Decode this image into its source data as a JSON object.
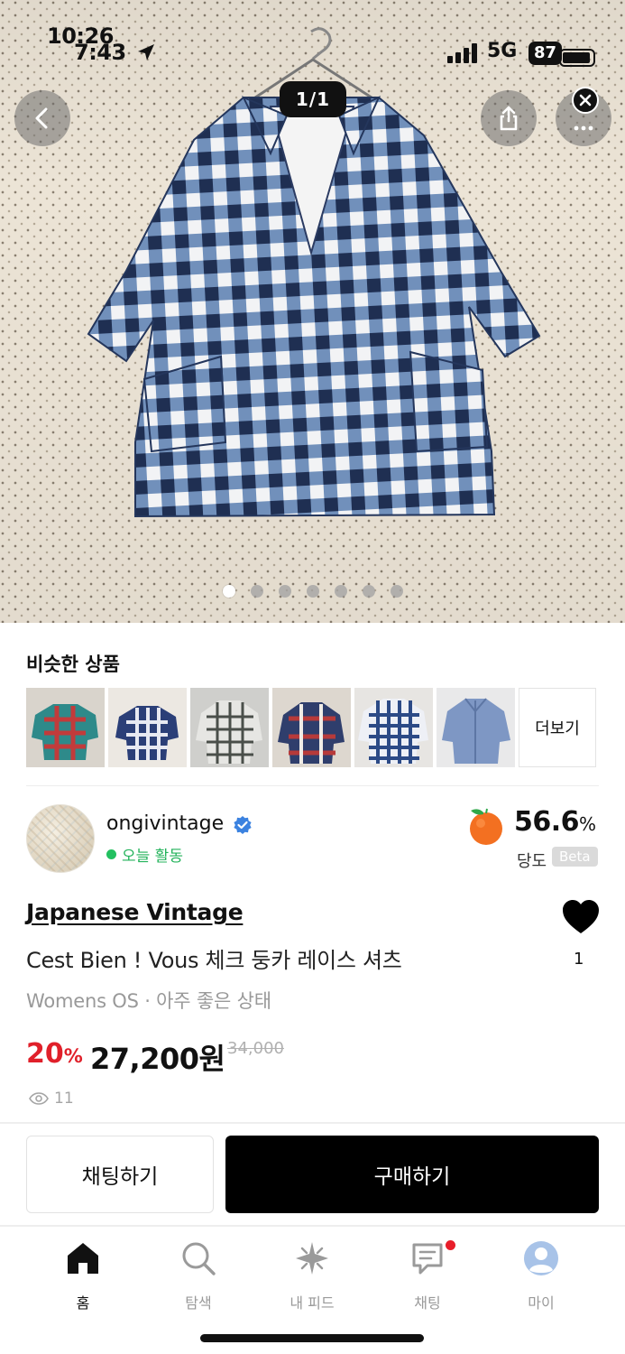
{
  "status_bar": {
    "time_back": "10:26",
    "time_front": "7:43",
    "network": "5G",
    "battery": "87"
  },
  "gallery": {
    "counter": "1/1",
    "dots_total": 7,
    "active_dot": 1
  },
  "similar": {
    "title": "비슷한 상품",
    "thumbnails": [
      "plaid-shirt-teal-red",
      "navy-gingham-blouse",
      "gray-check-shirt",
      "multicolor-plaid-shirt",
      "blue-check-shirt",
      "blue-chambray-shirt"
    ],
    "more_label": "더보기"
  },
  "seller": {
    "name": "ongivintage",
    "activity": "오늘 활동",
    "score": "56.6",
    "score_unit": "%",
    "score_label": "당도",
    "beta_label": "Beta"
  },
  "product": {
    "brand": "Japanese Vintage",
    "title": "Cest Bien ! Vous 체크 둥카 레이스 셔츠",
    "meta": "Womens OS · 아주 좋은 상태",
    "discount": "20",
    "discount_unit": "%",
    "price": "27,200원",
    "original_price": "34,000",
    "views": "11",
    "likes": "1"
  },
  "actions": {
    "chat_label": "채팅하기",
    "buy_label": "구매하기"
  },
  "tabs": [
    {
      "label": "홈",
      "icon": "home-icon",
      "active": true
    },
    {
      "label": "탐색",
      "icon": "search-icon",
      "active": false
    },
    {
      "label": "내 피드",
      "icon": "sparkle-icon",
      "active": false
    },
    {
      "label": "채팅",
      "icon": "chat-icon",
      "active": false
    },
    {
      "label": "마이",
      "icon": "profile-icon",
      "active": false
    }
  ],
  "colors": {
    "discount": "#e0202a",
    "activity": "#23b35b",
    "verified": "#3b82e0",
    "buy_button": "#000000"
  }
}
